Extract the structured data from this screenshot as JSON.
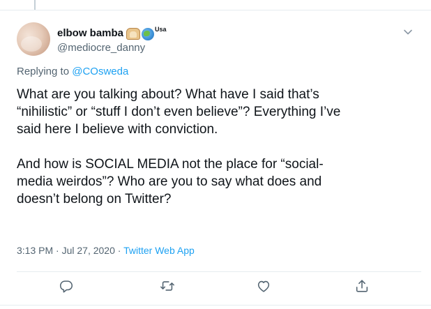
{
  "tweet": {
    "author": {
      "name": "elbow bamba",
      "usa_tag": "Usa",
      "handle": "@mediocre_danny"
    },
    "reply": {
      "prefix": "Replying to ",
      "handle": "@COsweda"
    },
    "body": {
      "line1": "What are you talking about?  What have I said that’s",
      "line2": "“nihilistic” or “stuff I don’t even believe”?  Everything I’ve",
      "line3": "said here I believe with conviction.",
      "line4": "And how is SOCIAL MEDIA not the place for “social-",
      "line5": "media weirdos”?  Who are you to say what does and",
      "line6": "doesn’t belong on Twitter?"
    },
    "meta": {
      "time": "3:13 PM",
      "sep1": " · ",
      "date": "Jul 27, 2020",
      "sep2": " · ",
      "source": "Twitter Web App"
    },
    "icons": {
      "emoji1": "bread-emoji-icon",
      "emoji2": "globe-emoji-icon",
      "caret": "chevron-down-icon",
      "reply": "reply-icon",
      "retweet": "retweet-icon",
      "like": "heart-icon",
      "share": "share-icon"
    },
    "colors": {
      "accent": "#1da1f2",
      "secondary_text": "#536471",
      "primary_text": "#0f1419",
      "divider": "#e6ecf0"
    }
  }
}
